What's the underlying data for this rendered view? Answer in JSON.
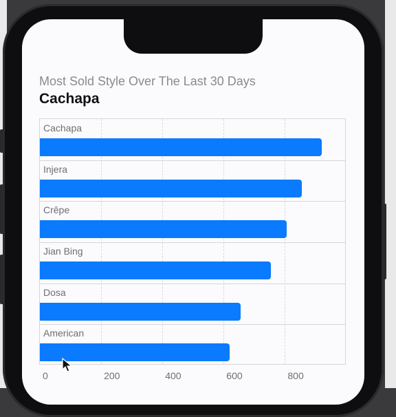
{
  "header": {
    "subtitle": "Most Sold Style Over The Last 30 Days",
    "title": "Cachapa"
  },
  "colors": {
    "bar": "#0a7aff",
    "background": "#fbfbfd"
  },
  "chart_data": {
    "type": "bar",
    "orientation": "horizontal",
    "categories": [
      "Cachapa",
      "Injera",
      "Crêpe",
      "Jian Bing",
      "Dosa",
      "American"
    ],
    "values": [
      920,
      855,
      805,
      755,
      655,
      620
    ],
    "xlim": [
      0,
      1000
    ],
    "ticks": [
      "0",
      "200",
      "400",
      "600",
      "800"
    ],
    "tick_values": [
      0,
      200,
      400,
      600,
      800
    ],
    "grid": true
  }
}
